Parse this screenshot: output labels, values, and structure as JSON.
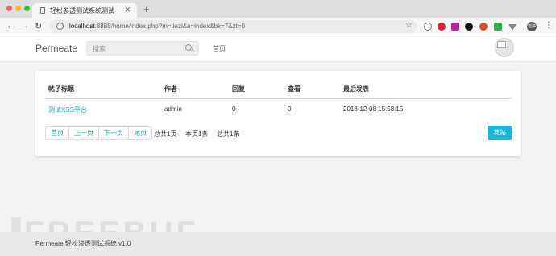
{
  "browser": {
    "tab_title": "轻松参透测试系统测试",
    "url_host": "localhost",
    "url_rest": ":8888/home/index.php?m=tiezi&a=index&bk=7&zt=0",
    "profile_label": "暂停"
  },
  "header": {
    "brand": "Permeate",
    "search_placeholder": "搜索",
    "nav_home": "首页"
  },
  "table": {
    "columns": [
      "帖子标题",
      "作者",
      "回复",
      "查看",
      "最后发表"
    ],
    "rows": [
      {
        "title": "测试XSS平台",
        "author": "admin",
        "replies": "0",
        "views": "0",
        "last_post": "2018-12-08 15:58:15"
      }
    ]
  },
  "pagination": {
    "buttons": [
      "首页",
      "上一页",
      "下一页",
      "尾页"
    ],
    "total_pages": "总共1页",
    "this_page": "本页1条",
    "total_items": "总共1条"
  },
  "post_button": "发帖",
  "watermark": "FREEBUF",
  "footer": "Permeate 轻松渗透测试系统 v1.0",
  "colors": {
    "accent": "#1ab7d6",
    "link": "#1aa8c6"
  }
}
